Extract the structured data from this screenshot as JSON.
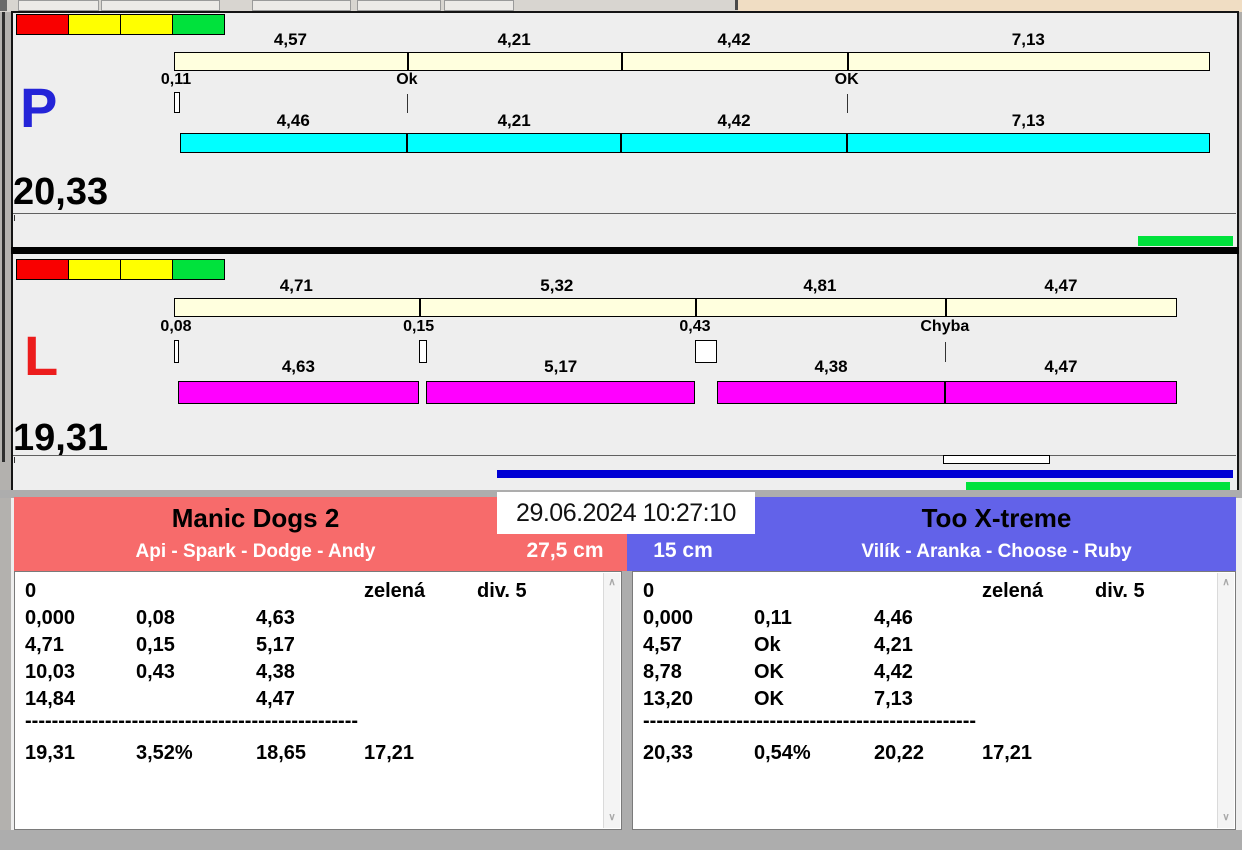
{
  "timestamp": "29.06.2024 10:27:10",
  "runs": [
    {
      "letter": "P",
      "letter_color": "#2424D8",
      "total_label": "20,33",
      "duration": 20.33,
      "lights": [
        "#F90000",
        "#FFFF00",
        "#FFFF00",
        "#00E23C"
      ],
      "split_color": "#FFFFDE",
      "run_color": "#00FFFF",
      "split_segments": [
        {
          "label": "4,57",
          "seconds": 4.57
        },
        {
          "label": "4,21",
          "seconds": 4.21
        },
        {
          "label": "4,42",
          "seconds": 4.42
        },
        {
          "label": "7,13",
          "seconds": 7.13
        }
      ],
      "markers": [
        {
          "label": "0,11",
          "at": 0,
          "seconds": 0.11,
          "style": "box"
        },
        {
          "label": "Ok",
          "at": 4.57,
          "seconds": 0,
          "style": "tick"
        },
        {
          "label": "OK",
          "at": 13.2,
          "seconds": 0,
          "style": "tick"
        }
      ],
      "run_segments": [
        {
          "label": "4,46",
          "start": 0.11,
          "seconds": 4.46
        },
        {
          "label": "4,21",
          "start": 4.57,
          "seconds": 4.21
        },
        {
          "label": "4,42",
          "start": 8.78,
          "seconds": 4.42
        },
        {
          "label": "7,13",
          "start": 13.2,
          "seconds": 7.13
        }
      ]
    },
    {
      "letter": "L",
      "letter_color": "#EC1C1C",
      "total_label": "19,31",
      "duration": 19.31,
      "lights": [
        "#F90000",
        "#FFFF00",
        "#FFFF00",
        "#00E23C"
      ],
      "split_color": "#FFFFDE",
      "run_color": "#FF00FF",
      "split_segments": [
        {
          "label": "4,71",
          "seconds": 4.71
        },
        {
          "label": "5,32",
          "seconds": 5.32
        },
        {
          "label": "4,81",
          "seconds": 4.81
        },
        {
          "label": "4,47",
          "seconds": 4.47
        }
      ],
      "markers": [
        {
          "label": "0,08",
          "at": 0,
          "seconds": 0.08,
          "style": "box"
        },
        {
          "label": "0,15",
          "at": 4.71,
          "seconds": 0.15,
          "style": "box"
        },
        {
          "label": "0,43",
          "at": 10.03,
          "seconds": 0.43,
          "style": "box"
        },
        {
          "label": "Chyba",
          "at": 14.84,
          "seconds": 0,
          "style": "tick"
        }
      ],
      "run_segments": [
        {
          "label": "4,63",
          "start": 0.08,
          "seconds": 4.63
        },
        {
          "label": "5,17",
          "start": 4.86,
          "seconds": 5.17
        },
        {
          "label": "4,38",
          "start": 10.46,
          "seconds": 4.38
        },
        {
          "label": "4,47",
          "start": 14.84,
          "seconds": 4.47
        }
      ]
    }
  ],
  "progress": {
    "p_green_bar_color": "#00E23C",
    "l_blue_bar_color": "#0000D4",
    "l_green_bar_color": "#00E23C"
  },
  "teams": [
    {
      "name": "Manic Dogs 2",
      "dogs": "Api - Spark - Dodge - Andy",
      "height": "27,5 cm",
      "header_color": "#F76B6B",
      "table": {
        "rows": [
          [
            "0",
            "",
            "",
            "zelená",
            "div. 5"
          ],
          [
            "0,000",
            "0,08",
            "4,63",
            "",
            ""
          ],
          [
            "4,71",
            "0,15",
            "5,17",
            "",
            ""
          ],
          [
            "10,03",
            "0,43",
            "4,38",
            "",
            ""
          ],
          [
            "14,84",
            "",
            "4,47",
            "",
            ""
          ]
        ],
        "divider": "--------------------------------------------------",
        "totals": [
          "19,31",
          "3,52%",
          "18,65",
          "17,21"
        ]
      }
    },
    {
      "name": "Too X-treme",
      "dogs": "Vilík - Aranka - Choose - Ruby",
      "height": "15 cm",
      "header_color": "#6262E9",
      "table": {
        "rows": [
          [
            "0",
            "",
            "",
            "zelená",
            "div. 5"
          ],
          [
            "0,000",
            "0,11",
            "4,46",
            "",
            ""
          ],
          [
            "4,57",
            "Ok",
            "4,21",
            "",
            ""
          ],
          [
            "8,78",
            "OK",
            "4,42",
            "",
            ""
          ],
          [
            "13,20",
            "OK",
            "7,13",
            "",
            ""
          ]
        ],
        "divider": "--------------------------------------------------",
        "totals": [
          "20,33",
          "0,54%",
          "20,22",
          "17,21"
        ]
      }
    }
  ],
  "scrollbar": {
    "up_glyph": "∧",
    "down_glyph": "∨"
  }
}
